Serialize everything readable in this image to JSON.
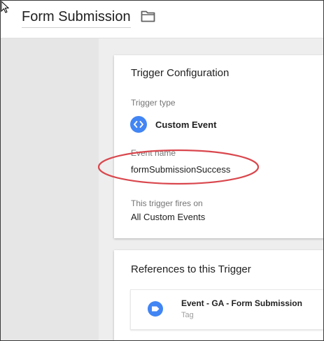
{
  "header": {
    "title": "Form Submission",
    "folder_icon": "folder-icon"
  },
  "trigger_config": {
    "heading": "Trigger Configuration",
    "type_label": "Trigger type",
    "type_value": "Custom Event",
    "type_icon": "code-brackets-icon",
    "event_name_label": "Event name",
    "event_name_value": "formSubmissionSuccess",
    "fires_on_label": "This trigger fires on",
    "fires_on_value": "All Custom Events"
  },
  "references": {
    "heading": "References to this Trigger",
    "items": [
      {
        "name": "Event - GA - Form Submission",
        "type": "Tag",
        "icon": "tag-icon"
      }
    ]
  },
  "colors": {
    "accent_blue": "#4285f4",
    "highlight_red": "#d9474d",
    "header_bg": "#ffffff",
    "page_bg": "#eeeeee"
  }
}
